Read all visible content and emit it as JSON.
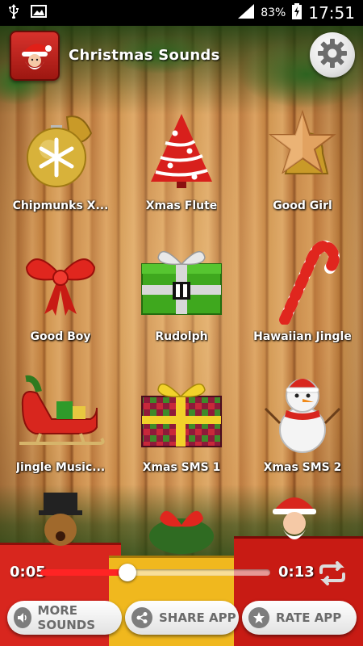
{
  "status_bar": {
    "battery_percent": "83%",
    "time": "17:51",
    "icons": [
      "usb-icon",
      "image-icon",
      "signal-icon",
      "battery-charging-icon"
    ]
  },
  "header": {
    "title": "Christmas Sounds",
    "logo_icon": "santa-icon",
    "settings_icon": "gear-icon"
  },
  "sounds": [
    {
      "label": "Chipmunks X...",
      "icon": "snowflake-ornament-icon"
    },
    {
      "label": "Xmas Flute",
      "icon": "christmas-tree-icon"
    },
    {
      "label": "Good Girl",
      "icon": "star-bell-icon"
    },
    {
      "label": "Good Boy",
      "icon": "red-bow-icon"
    },
    {
      "label": "Rudolph",
      "icon": "green-gift-pause-icon",
      "state": "playing"
    },
    {
      "label": "Hawaiian Jingle",
      "icon": "candy-cane-icon"
    },
    {
      "label": "Jingle Music...",
      "icon": "sleigh-icon"
    },
    {
      "label": "Xmas SMS 1",
      "icon": "plaid-gift-icon"
    },
    {
      "label": "Xmas SMS 2",
      "icon": "snowman-icon"
    }
  ],
  "player": {
    "current_time": "0:05",
    "total_time": "0:13",
    "progress": 0.38,
    "repeat_icon": "repeat-icon"
  },
  "buttons": {
    "more_sounds": "MORE SOUNDS",
    "share_app": "SHARE APP",
    "rate_app": "RATE APP"
  },
  "colors": {
    "seek_fill": "#ff2424",
    "title_text": "#ffffff",
    "button_text": "#6b6b6b"
  }
}
